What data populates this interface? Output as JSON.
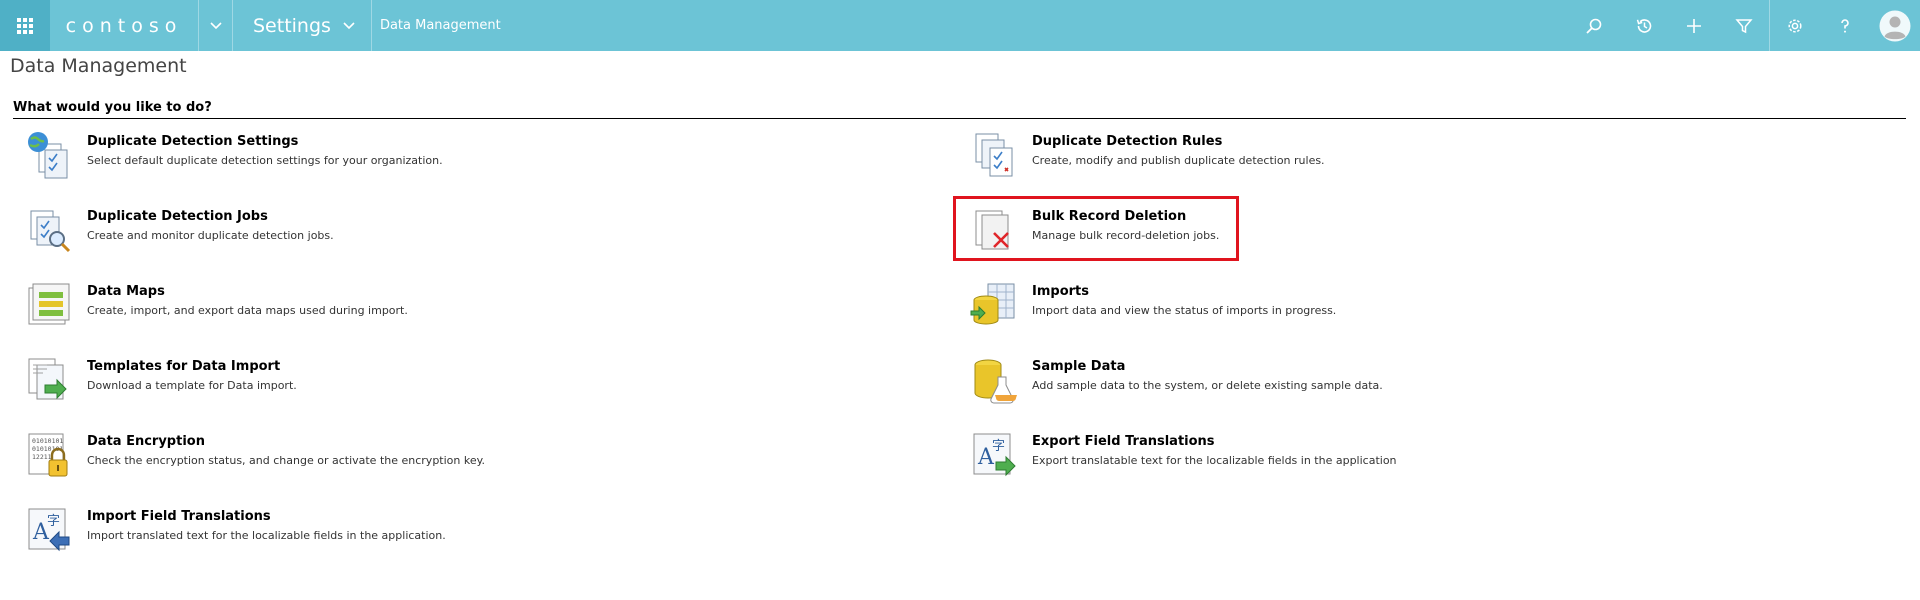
{
  "brand": "contoso",
  "nav": {
    "area_label": "Settings",
    "breadcrumb": "Data Management",
    "icons": [
      "search-icon",
      "history-icon",
      "plus-icon",
      "filter-icon",
      "gear-icon",
      "help-icon",
      "avatar-icon"
    ]
  },
  "page": {
    "title": "Data Management",
    "section_heading": "What would you like to do?"
  },
  "items_left": [
    {
      "title": "Duplicate Detection Settings",
      "desc": "Select default duplicate detection settings for your organization.",
      "icon": "globe-documents-icon"
    },
    {
      "title": "Duplicate Detection Jobs",
      "desc": "Create and monitor duplicate detection jobs.",
      "icon": "documents-magnifier-icon"
    },
    {
      "title": "Data Maps",
      "desc": "Create, import, and export data maps used during import.",
      "icon": "data-map-icon"
    },
    {
      "title": "Templates for Data Import",
      "desc": "Download a template for Data import.",
      "icon": "template-arrow-icon"
    },
    {
      "title": "Data Encryption",
      "desc": "Check the encryption status, and change or activate the encryption key.",
      "icon": "binary-lock-icon"
    },
    {
      "title": "Import Field Translations",
      "desc": "Import translated text for the localizable fields in the application.",
      "icon": "translation-import-icon"
    }
  ],
  "items_right": [
    {
      "title": "Duplicate Detection Rules",
      "desc": "Create, modify and publish duplicate detection rules.",
      "icon": "documents-rules-icon"
    },
    {
      "title": "Bulk Record Deletion",
      "desc": "Manage bulk record-deletion jobs.",
      "icon": "documents-delete-icon"
    },
    {
      "title": "Imports",
      "desc": "Import data and view the status of imports in progress.",
      "icon": "database-grid-icon"
    },
    {
      "title": "Sample Data",
      "desc": "Add sample data to the system, or delete existing sample data.",
      "icon": "database-flask-icon"
    },
    {
      "title": "Export Field Translations",
      "desc": "Export translatable text for the localizable fields in the application",
      "icon": "translation-export-icon"
    }
  ],
  "colors": {
    "topbar": "#6cc4d6",
    "waffle": "#4fb0c6",
    "highlight": "#e0141e"
  }
}
